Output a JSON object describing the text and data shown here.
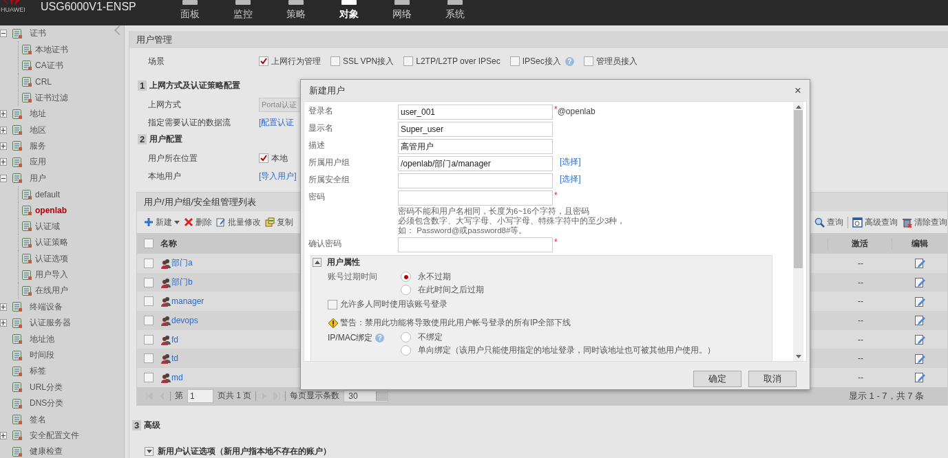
{
  "header": {
    "logo": "HUAWEI",
    "product": "USG6000V1-ENSP",
    "nav": [
      {
        "label": "面板",
        "selected": false
      },
      {
        "label": "监控",
        "selected": false
      },
      {
        "label": "策略",
        "selected": false
      },
      {
        "label": "对象",
        "selected": true
      },
      {
        "label": "网络",
        "selected": false
      },
      {
        "label": "系统",
        "selected": false
      }
    ]
  },
  "sidebar": {
    "items": [
      {
        "label": "证书",
        "selected": false,
        "expanded": true,
        "children": [
          {
            "label": "本地证书",
            "selected": false
          },
          {
            "label": "CA证书",
            "selected": false
          },
          {
            "label": "CRL",
            "selected": false
          },
          {
            "label": "证书过滤",
            "selected": false
          }
        ]
      },
      {
        "label": "地址",
        "selected": false,
        "expanded": false
      },
      {
        "label": "地区",
        "selected": false,
        "expanded": false
      },
      {
        "label": "服务",
        "selected": false,
        "expanded": false
      },
      {
        "label": "应用",
        "selected": false,
        "expanded": false
      },
      {
        "label": "用户",
        "selected": false,
        "expanded": true,
        "children": [
          {
            "label": "default",
            "selected": false
          },
          {
            "label": "openlab",
            "selected": true
          },
          {
            "label": "认证域",
            "selected": false
          },
          {
            "label": "认证策略",
            "selected": false
          },
          {
            "label": "认证选项",
            "selected": false
          },
          {
            "label": "用户导入",
            "selected": false
          },
          {
            "label": "在线用户",
            "selected": false
          }
        ]
      },
      {
        "label": "终端设备",
        "selected": false,
        "expanded": false
      },
      {
        "label": "认证服务器",
        "selected": false,
        "expanded": false
      },
      {
        "label": "地址池",
        "selected": false
      },
      {
        "label": "时间段",
        "selected": false
      },
      {
        "label": "标签",
        "selected": false
      },
      {
        "label": "URL分类",
        "selected": false
      },
      {
        "label": "DNS分类",
        "selected": false
      },
      {
        "label": "签名",
        "selected": false
      },
      {
        "label": "安全配置文件",
        "selected": false,
        "expanded": false
      },
      {
        "label": "健康检查",
        "selected": false
      }
    ]
  },
  "panel": {
    "title": "用户管理",
    "scene": {
      "label": "场景",
      "options": [
        {
          "label": "上网行为管理",
          "checked": true
        },
        {
          "label": "SSL VPN接入",
          "checked": false
        },
        {
          "label": "L2TP/L2TP over IPSec",
          "checked": false
        },
        {
          "label": "IPSec接入",
          "checked": false,
          "help": "?"
        },
        {
          "label": "管理员接入",
          "checked": false
        }
      ]
    },
    "sections": [
      {
        "number": "1",
        "title": "上网方式及认证策略配置",
        "rows": [
          {
            "label": "上网方式",
            "kind": "select",
            "value": "Portal认证",
            "disabled": true
          },
          {
            "label": "指定需要认证的数据流",
            "kind": "link",
            "value": "[配置认证"
          }
        ]
      },
      {
        "number": "2",
        "title": "用户配置",
        "rows": [
          {
            "label": "用户所在位置",
            "kind": "checkbox",
            "value": "本地",
            "checked": true
          },
          {
            "label": "本地用户",
            "kind": "link",
            "value": "[导入用户]"
          }
        ]
      }
    ],
    "list": {
      "title": "用户/用户组/安全组管理列表",
      "toolbar": [
        {
          "label": "新建",
          "kind": "new"
        },
        {
          "label": "删除",
          "kind": "delete"
        },
        {
          "label": "批量修改",
          "kind": "batch"
        },
        {
          "label": "复制",
          "kind": "copy"
        }
      ],
      "toolbar_right": [
        {
          "label": "查询",
          "kind": "search"
        },
        {
          "label": "高级查询",
          "kind": "advanced"
        },
        {
          "label": "清除查询",
          "kind": "clear"
        }
      ],
      "columns": [
        "名称",
        "激活",
        "编辑"
      ],
      "select_all_checked": false,
      "rows": [
        {
          "name": "部门a",
          "active": "--",
          "checked": false
        },
        {
          "name": "部门b",
          "active": "--",
          "checked": false
        },
        {
          "name": "manager",
          "active": "--",
          "checked": false
        },
        {
          "name": "devops",
          "active": "--",
          "checked": false
        },
        {
          "name": "fd",
          "active": "--",
          "checked": false
        },
        {
          "name": "td",
          "active": "--",
          "checked": false
        },
        {
          "name": "md",
          "active": "--",
          "checked": false
        }
      ],
      "pager": {
        "page_label": "第",
        "page": "1",
        "total": "页共 1 页",
        "per_page_label": "每页显示条数",
        "per_page": "30",
        "summary": "显示 1 - 7，共 7 条"
      }
    },
    "advanced": {
      "number": "3",
      "title": "高级",
      "option": "新用户认证选项（新用户指本地不存在的账户）"
    }
  },
  "dialog": {
    "title": "新建用户",
    "close": "×",
    "fields": [
      {
        "label": "登录名",
        "value": "user_001",
        "mark": "*",
        "suffix": "@openlab"
      },
      {
        "label": "显示名",
        "value": "Super_user"
      },
      {
        "label": "描述",
        "value": "高管用户"
      },
      {
        "label": "所属用户组",
        "value": "/openlab/部门a/manager",
        "link": "[选择]"
      },
      {
        "label": "所属安全组",
        "link": "[选择]"
      },
      {
        "label": "密码",
        "mark": "*",
        "hint": [
          "密码不能和用户名相同，长度为6~16个字符，且密码",
          "必须包含数字、大写字母、小写字母、特殊字符中的至少3种，",
          "如： Password@或password8#等。"
        ]
      },
      {
        "label": "确认密码",
        "mark": "*"
      }
    ],
    "attributes": {
      "title": "用户属性",
      "expanded": true,
      "expiry": {
        "label": "账号过期时间",
        "options": [
          {
            "label": "永不过期",
            "selected": true
          },
          {
            "label": "在此时间之后过期",
            "selected": false
          }
        ]
      },
      "multi_login": {
        "label": "允许多人同时使用该账号登录",
        "checked": false
      },
      "warning": "警告：禁用此功能将导致使用此用户帐号登录的所有IP全部下线",
      "binding": {
        "label": "IP/MAC绑定",
        "help": "?",
        "options": [
          {
            "label": "不绑定",
            "selected": false
          },
          {
            "label": "单向绑定（该用户只能使用指定的地址登录，同时该地址也可被其他用户使用。）",
            "selected": false
          }
        ]
      }
    },
    "buttons": [
      "确定",
      "取消"
    ]
  }
}
